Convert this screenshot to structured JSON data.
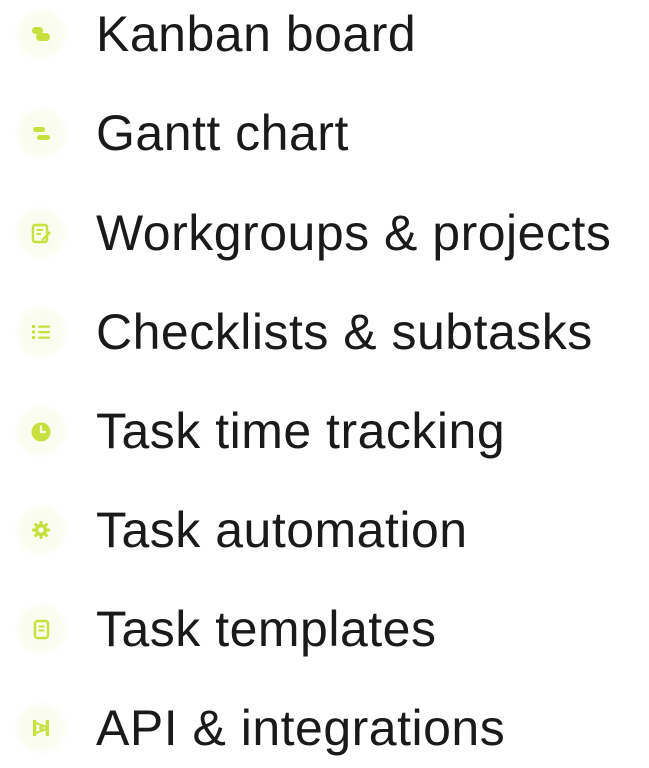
{
  "features": [
    {
      "label": "Kanban board",
      "icon": "kanban-icon"
    },
    {
      "label": "Gantt chart",
      "icon": "gantt-icon"
    },
    {
      "label": "Workgroups & projects",
      "icon": "edit-document-icon"
    },
    {
      "label": "Checklists & subtasks",
      "icon": "checklist-icon"
    },
    {
      "label": "Task time tracking",
      "icon": "clock-icon"
    },
    {
      "label": "Task automation",
      "icon": "gear-icon"
    },
    {
      "label": "Task templates",
      "icon": "template-icon"
    },
    {
      "label": "API & integrations",
      "icon": "api-icon"
    }
  ],
  "colors": {
    "icon_accent": "#c7e040",
    "icon_halo": "#f7fbe6",
    "text": "#1a1a1a"
  }
}
